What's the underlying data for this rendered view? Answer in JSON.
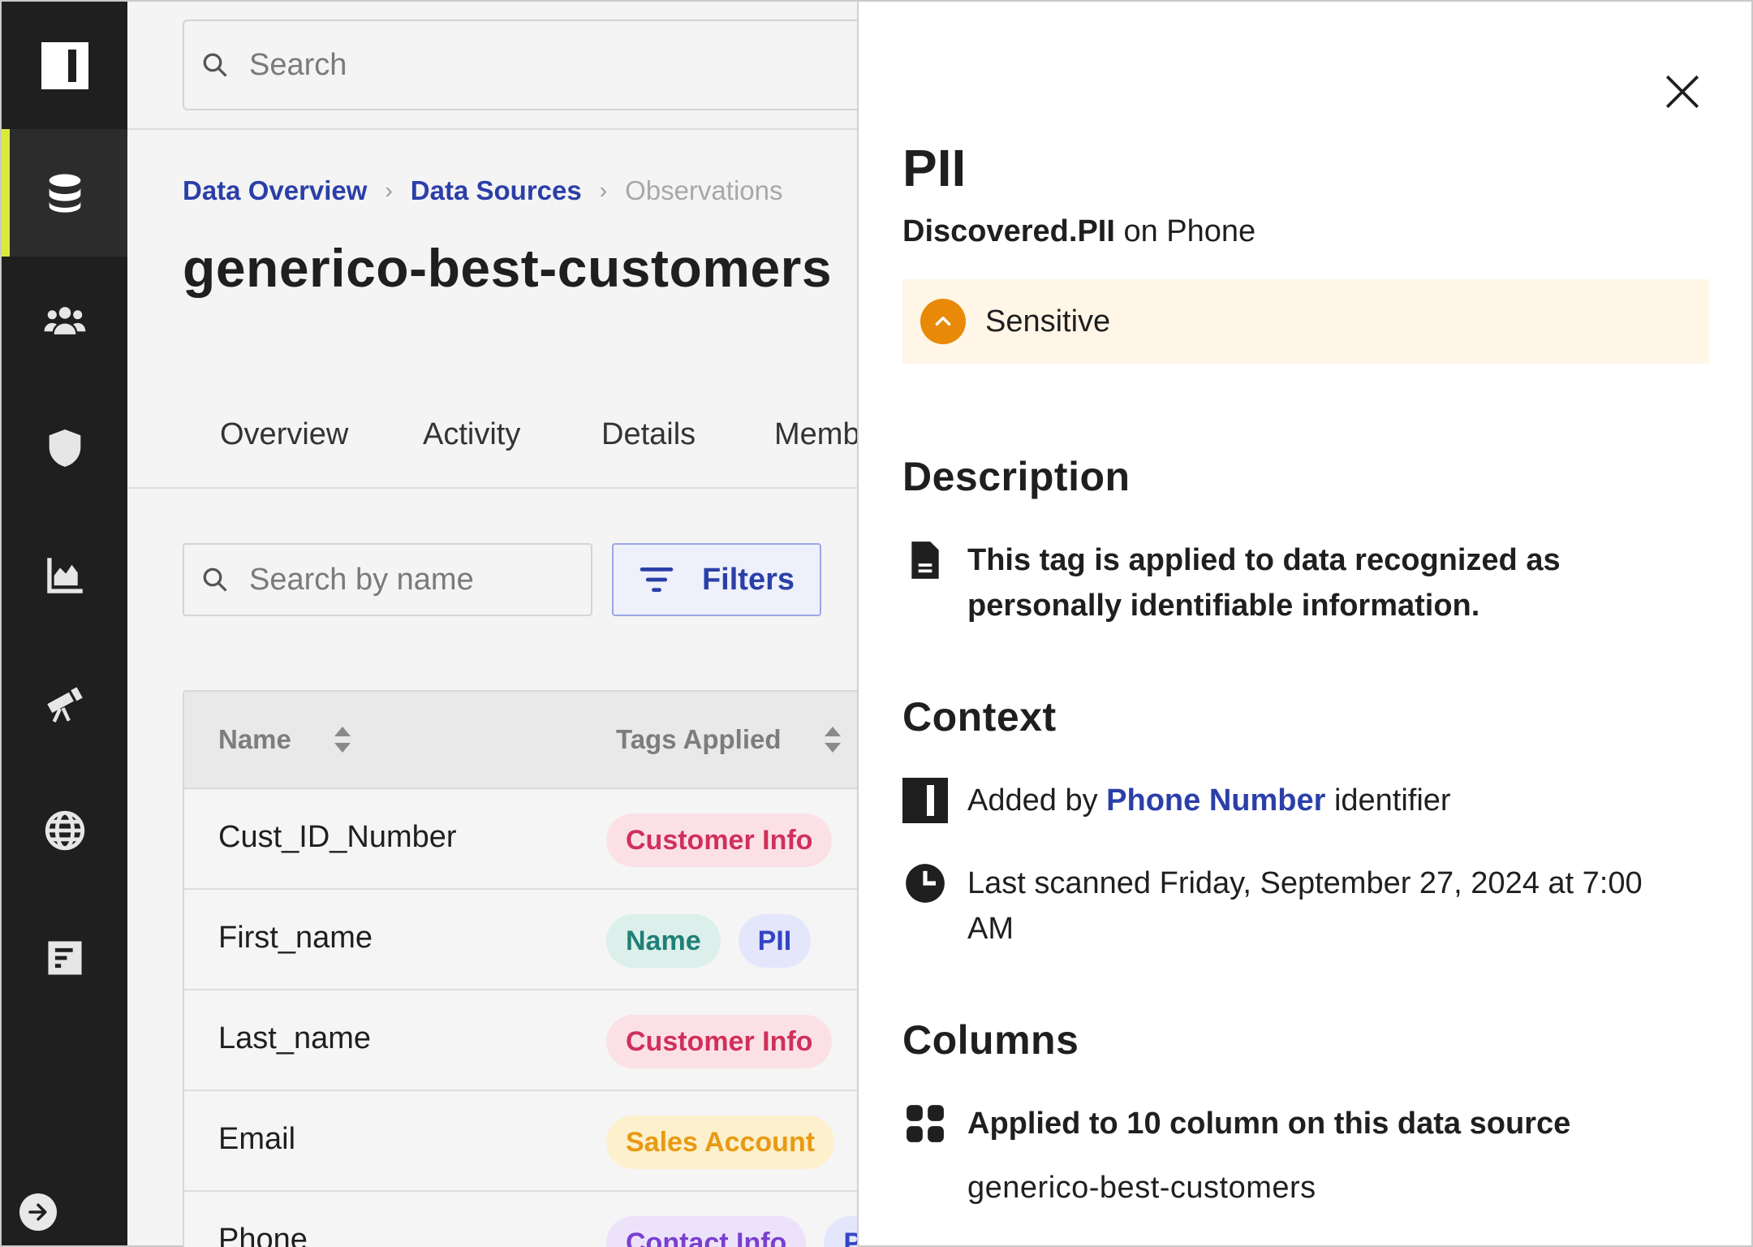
{
  "search": {
    "placeholder": "Search"
  },
  "breadcrumb": {
    "items": [
      "Data Overview",
      "Data Sources"
    ],
    "current": "Observations",
    "separator": "›"
  },
  "page": {
    "title": "generico-best-customers"
  },
  "tabs": [
    "Overview",
    "Activity",
    "Details",
    "Memb"
  ],
  "toolbar": {
    "search_placeholder": "Search by name",
    "filters_label": "Filters"
  },
  "table": {
    "columns": [
      "Name",
      "Tags Applied"
    ],
    "rows": [
      {
        "name": "Cust_ID_Number",
        "tags": [
          "Customer Info"
        ]
      },
      {
        "name": "First_name",
        "tags": [
          "Name",
          "PII"
        ]
      },
      {
        "name": "Last_name",
        "tags": [
          "Customer Info"
        ]
      },
      {
        "name": "Email",
        "tags": [
          "Sales Account"
        ]
      },
      {
        "name": "Phone",
        "tags": [
          "Contact Info",
          "P"
        ]
      }
    ]
  },
  "drawer": {
    "title": "PII",
    "subtitle_bold": "Discovered.PII",
    "subtitle_rest": " on Phone",
    "sensitivity": "Sensitive",
    "description_heading": "Description",
    "description_text": "This tag is applied to data recognized as personally identifiable information.",
    "context_heading": "Context",
    "added_by_prefix": "Added by ",
    "added_by_link": "Phone Number",
    "added_by_suffix": " identifier",
    "last_scanned": "Last scanned Friday, September 27, 2024 at 7:00 AM",
    "columns_heading": "Columns",
    "columns_applied": "Applied to 10 column on this data source",
    "columns_source": "generico-best-customers"
  },
  "colors": {
    "sidebar_bg": "#1f1f1f",
    "active_indicator": "#d9ea3b",
    "link": "#2b3fa8",
    "sensitive": "#e88a08",
    "sensitive_bg": "#fff6e8"
  },
  "icons": {
    "sidebar": [
      "database-icon",
      "users-icon",
      "shield-icon",
      "chart-icon",
      "telescope-icon",
      "globe-icon",
      "report-icon"
    ],
    "collapse": "arrow-right-circle-icon"
  }
}
